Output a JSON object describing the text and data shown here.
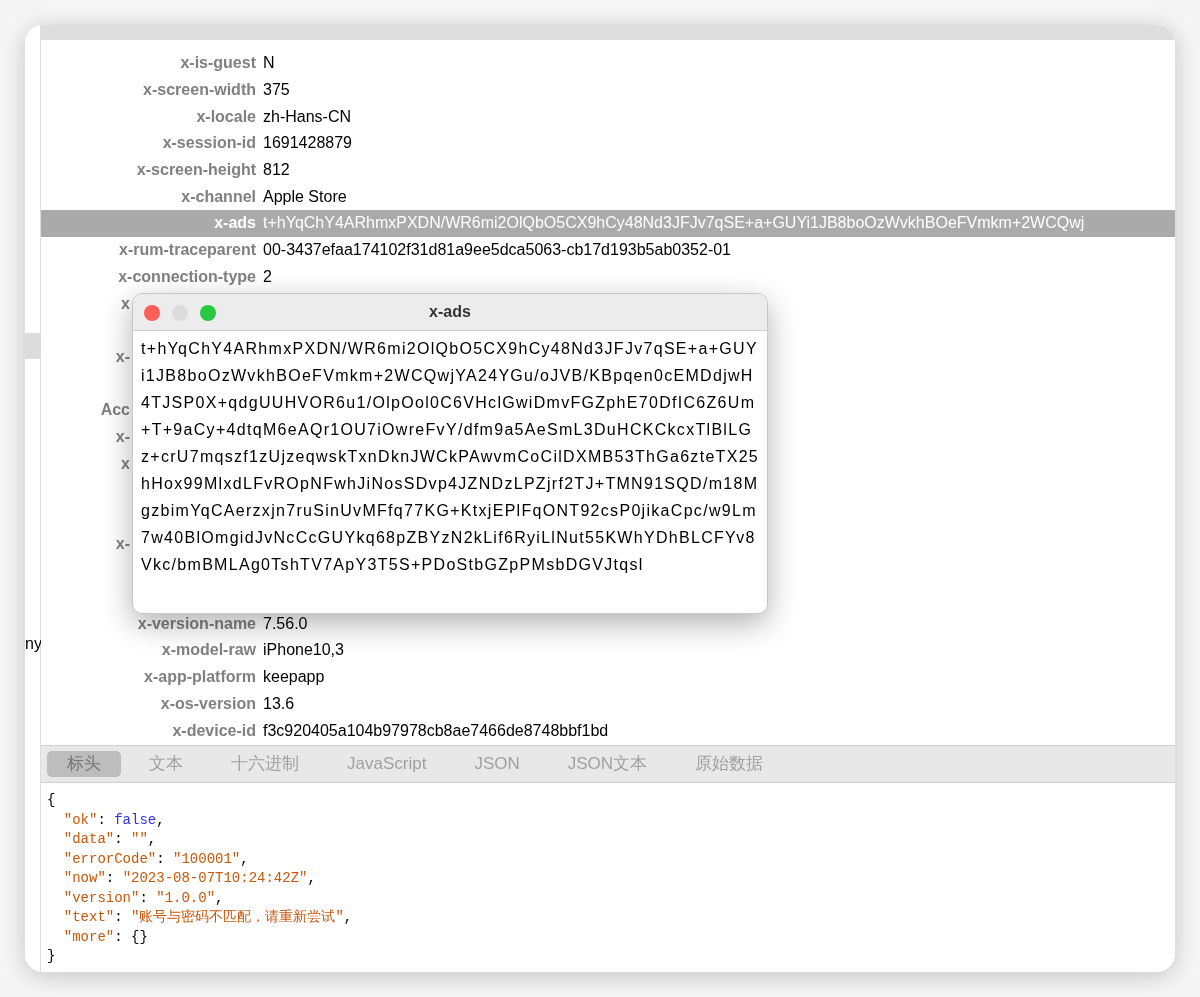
{
  "side_pane": {
    "fragment": "ny"
  },
  "headers": [
    {
      "kind": "row",
      "name": "x-is-guest",
      "value": "N",
      "selected": false
    },
    {
      "kind": "row",
      "name": "x-screen-width",
      "value": "375",
      "selected": false
    },
    {
      "kind": "row",
      "name": "x-locale",
      "value": "zh-Hans-CN",
      "selected": false
    },
    {
      "kind": "row",
      "name": "x-session-id",
      "value": "1691428879",
      "selected": false
    },
    {
      "kind": "row",
      "name": "x-screen-height",
      "value": "812",
      "selected": false
    },
    {
      "kind": "row",
      "name": "x-channel",
      "value": "Apple Store",
      "selected": false
    },
    {
      "kind": "row",
      "name": "x-ads",
      "value": "t+hYqChY4ARhmxPXDN/WR6mi2OlQbO5CX9hCy48Nd3JFJv7qSE+a+GUYi1JB8boOzWvkhBOeFVmkm+2WCQwj",
      "selected": true
    },
    {
      "kind": "row",
      "name": "x-rum-traceparent",
      "value": "00-3437efaa174102f31d81a9ee5dca5063-cb17d193b5ab0352-01",
      "selected": false
    },
    {
      "kind": "row",
      "name": "x-connection-type",
      "value": "2",
      "selected": false
    },
    {
      "kind": "occluded",
      "name": "x"
    },
    {
      "kind": "occluded"
    },
    {
      "kind": "occluded",
      "name": "x-"
    },
    {
      "kind": "occluded"
    },
    {
      "kind": "occluded",
      "name": "Acc"
    },
    {
      "kind": "occluded",
      "name": "x-"
    },
    {
      "kind": "occluded",
      "name": "x"
    },
    {
      "kind": "occluded"
    },
    {
      "kind": "occluded"
    },
    {
      "kind": "occluded",
      "name": "x-"
    },
    {
      "kind": "occluded"
    },
    {
      "kind": "occluded"
    },
    {
      "kind": "row",
      "name": "x-version-name",
      "value": "7.56.0",
      "selected": false
    },
    {
      "kind": "row",
      "name": "x-model-raw",
      "value": "iPhone10,3",
      "selected": false
    },
    {
      "kind": "row",
      "name": "x-app-platform",
      "value": "keepapp",
      "selected": false
    },
    {
      "kind": "row",
      "name": "x-os-version",
      "value": "13.6",
      "selected": false
    },
    {
      "kind": "row",
      "name": "x-device-id",
      "value": "f3c920405a104b97978cb8ae7466de8748bbf1bd",
      "selected": false
    }
  ],
  "response_tabs": [
    {
      "label": "标头",
      "selected": true
    },
    {
      "label": "文本",
      "selected": false
    },
    {
      "label": "十六进制",
      "selected": false
    },
    {
      "label": "JavaScript",
      "selected": false
    },
    {
      "label": "JSON",
      "selected": false
    },
    {
      "label": "JSON文本",
      "selected": false
    },
    {
      "label": "原始数据",
      "selected": false
    }
  ],
  "response_body": {
    "open": "{",
    "close": "}",
    "entries": [
      {
        "kind": "keyword",
        "key": "\"ok\"",
        "colon": ": ",
        "value": "false",
        "comma": ","
      },
      {
        "kind": "string",
        "key": "\"data\"",
        "colon": ": ",
        "value": "\"\"",
        "comma": ","
      },
      {
        "kind": "string",
        "key": "\"errorCode\"",
        "colon": ": ",
        "value": "\"100001\"",
        "comma": ","
      },
      {
        "kind": "string",
        "key": "\"now\"",
        "colon": ": ",
        "value": "\"2023-08-07T10:24:42Z\"",
        "comma": ","
      },
      {
        "kind": "string",
        "key": "\"version\"",
        "colon": ": ",
        "value": "\"1.0.0\"",
        "comma": ","
      },
      {
        "kind": "string",
        "key": "\"text\"",
        "colon": ": ",
        "value": "\"账号与密码不匹配，请重新尝试\"",
        "comma": ","
      },
      {
        "kind": "punct",
        "key": "\"more\"",
        "colon": ": ",
        "value": "{}"
      }
    ]
  },
  "popup": {
    "title": "x-ads",
    "text": "t+hYqChY4ARhmxPXDN/WR6mi2OlQbO5CX9hCy48Nd3JFJv7qSE+a+GUYi1JB8boOzWvkhBOeFVmkm+2WCQwjYA24YGu/oJVB/KBpqen0cEMDdjwH4TJSP0X+qdgUUHVOR6u1/OlpOol0C6VHclGwiDmvFGZphE70DfIC6Z6Um+T+9aCy+4dtqM6eAQr1OU7iOwreFvY/dfm9a5AeSmL3DuHCKCkcxTlBlLGz+crU7mqszf1zUjzeqwskTxnDknJWCkPAwvmCoCilDXMB53ThGa6zteTX25hHox99MlxdLFvROpNFwhJiNosSDvp4JZNDzLPZjrf2TJ+TMN91SQD/m18MgzbimYqCAerzxjn7ruSinUvMFfq77KG+KtxjEPlFqONT92csP0jikaCpc/w9Lm7w40BlOmgidJvNcCcGUYkq68pZBYzN2kLif6RyiLlNut55KWhYDhBLCFYv8Vkc/bmBMLAg0TshTV7ApY3T5S+PDoStbGZpPMsbDGVJtqsl"
  }
}
